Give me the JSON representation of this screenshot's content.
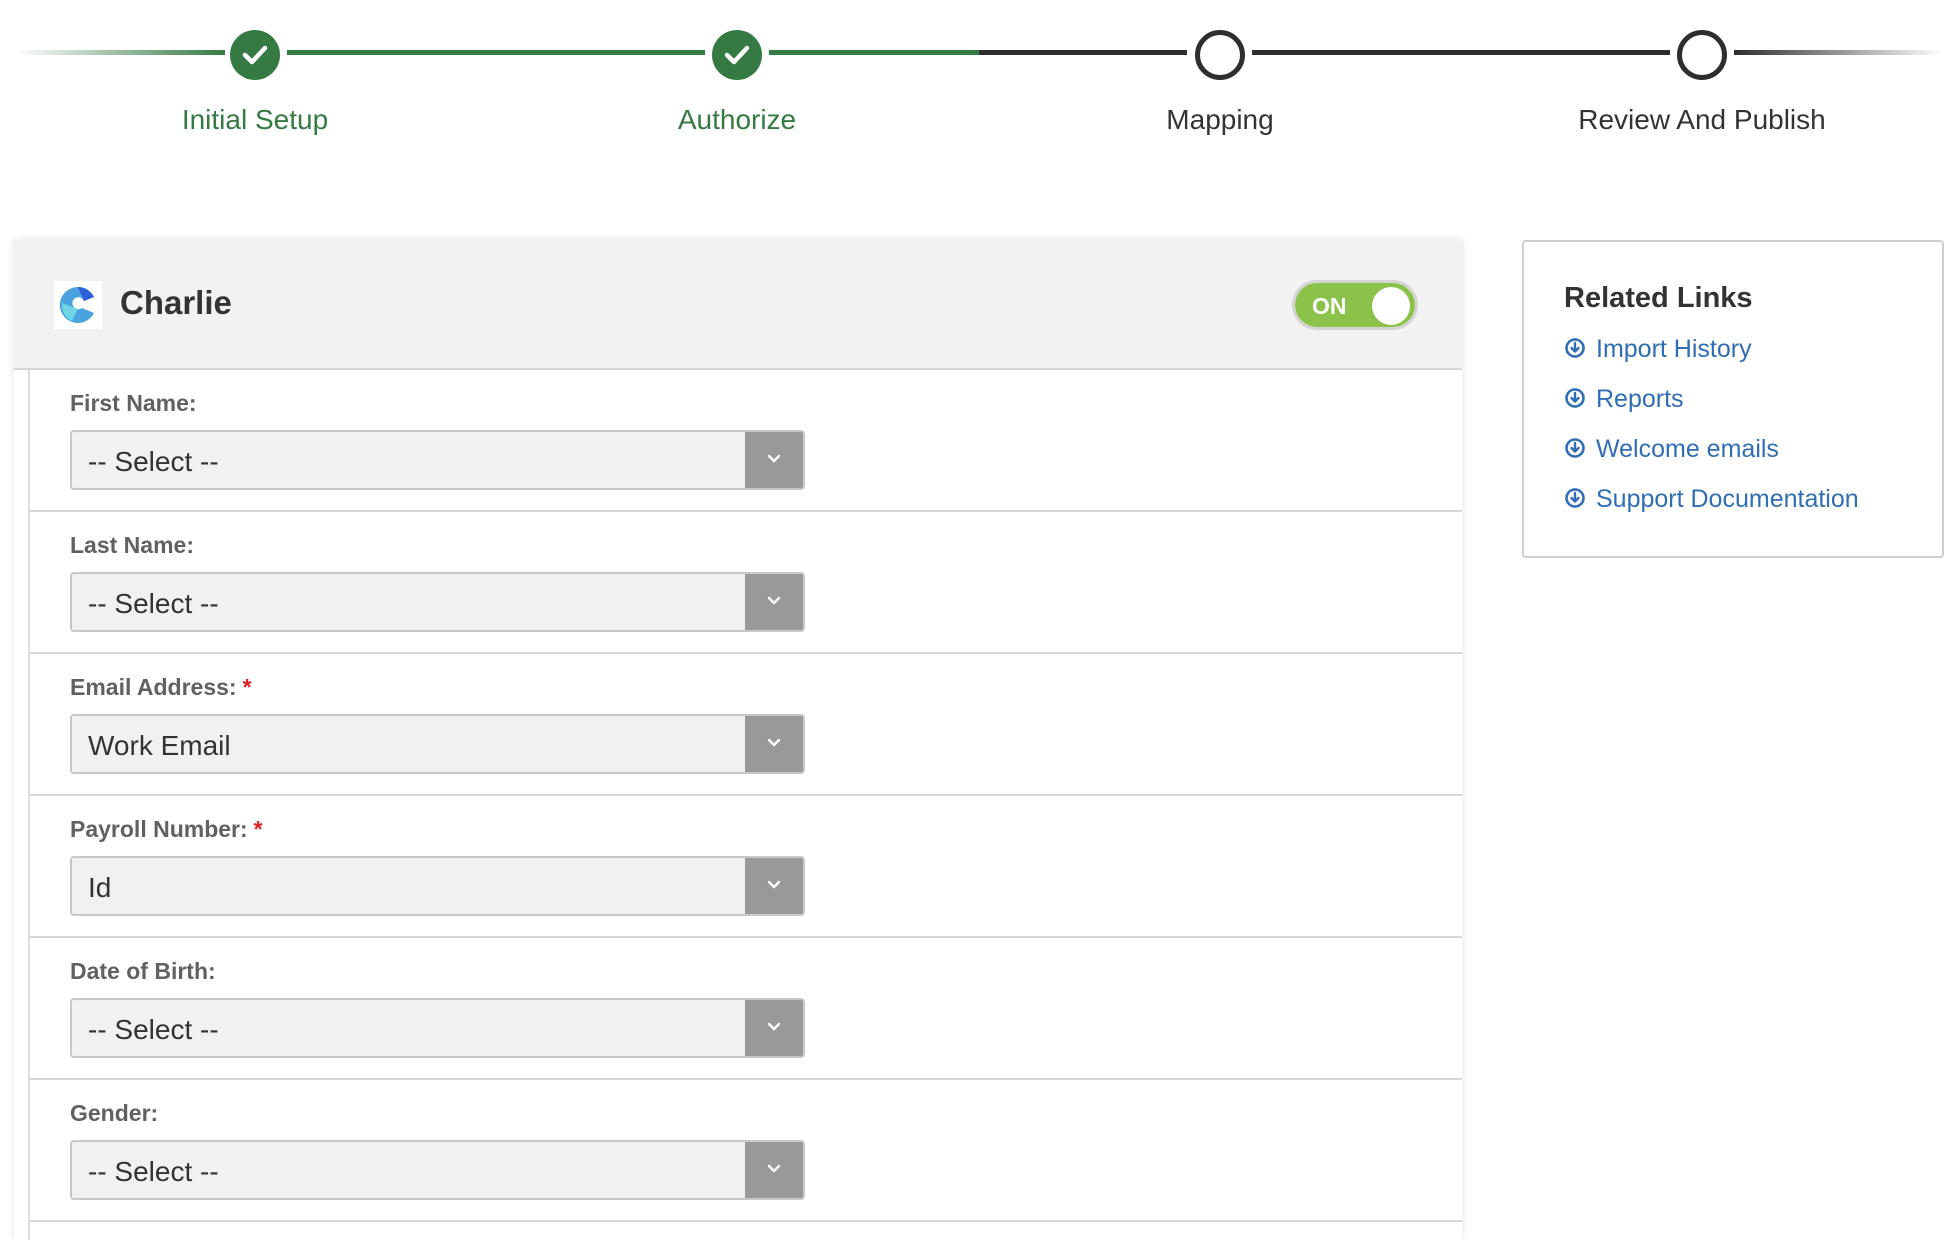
{
  "stepper": {
    "steps": [
      {
        "label": "Initial Setup",
        "status": "complete",
        "icon": "check-icon"
      },
      {
        "label": "Authorize",
        "status": "complete",
        "icon": "check-icon"
      },
      {
        "label": "Mapping",
        "status": "pending",
        "icon": "empty-circle-icon"
      },
      {
        "label": "Review And Publish",
        "status": "pending",
        "icon": "empty-circle-icon"
      }
    ],
    "colors": {
      "complete": "#357a43",
      "pending": "#2e2e2e"
    }
  },
  "integration": {
    "name": "Charlie",
    "logo": "charlie-logo-icon",
    "toggle": {
      "label": "ON",
      "state": true,
      "color": "#8bc34a"
    }
  },
  "fields": [
    {
      "label": "First Name:",
      "required": false,
      "value": "-- Select --"
    },
    {
      "label": "Last Name:",
      "required": false,
      "value": "-- Select --"
    },
    {
      "label": "Email Address:",
      "required": true,
      "value": "Work Email"
    },
    {
      "label": "Payroll Number:",
      "required": true,
      "value": "Id"
    },
    {
      "label": "Date of Birth:",
      "required": false,
      "value": "-- Select --"
    },
    {
      "label": "Gender:",
      "required": false,
      "value": "-- Select --"
    }
  ],
  "required_marker": "*",
  "related_links": {
    "title": "Related Links",
    "items": [
      {
        "label": "Import History",
        "icon": "circle-arrow-down-icon"
      },
      {
        "label": "Reports",
        "icon": "circle-arrow-down-icon"
      },
      {
        "label": "Welcome emails",
        "icon": "circle-arrow-down-icon"
      },
      {
        "label": "Support Documentation",
        "icon": "circle-arrow-down-icon"
      }
    ],
    "link_color": "#2f6db5"
  }
}
